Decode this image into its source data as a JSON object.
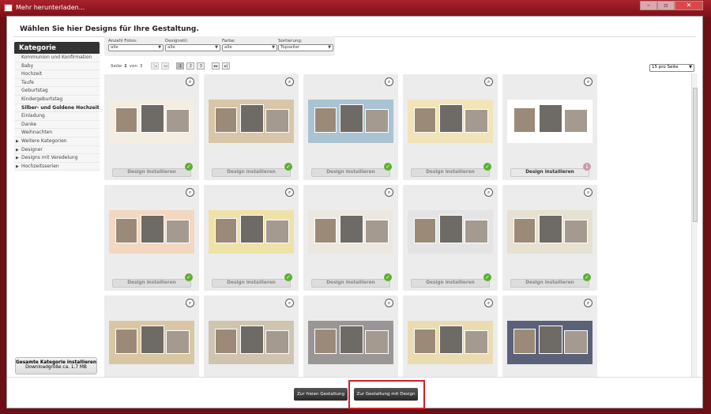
{
  "window": {
    "title": "Mehr herunterladen...",
    "controls": [
      "–",
      "▫",
      "✕"
    ]
  },
  "header": "Wählen Sie hier Designs für Ihre Gestaltung.",
  "sidebar": {
    "title": "Kategorie",
    "items": [
      {
        "label": "Kommunion und Konfirmation"
      },
      {
        "label": "Baby"
      },
      {
        "label": "Hochzeit"
      },
      {
        "label": "Taufe"
      },
      {
        "label": "Geburtstag"
      },
      {
        "label": "Kindergeburtstag"
      },
      {
        "label": "Silber- und Goldene Hochzeit",
        "selected": true
      },
      {
        "label": "Einladung"
      },
      {
        "label": "Danke"
      },
      {
        "label": "Weihnachten"
      },
      {
        "label": "Weitere Kategorien",
        "tree": true
      },
      {
        "label": "Designer",
        "tree": true
      },
      {
        "label": "Designs mit Veredelung",
        "tree": true
      },
      {
        "label": "Hochzeitsserien",
        "tree": true
      }
    ],
    "install_all": {
      "label": "Gesamte Kategorie installieren",
      "size": "Downloadgröße ca. 1.7 MB"
    }
  },
  "filters": [
    {
      "label": "Anzahl Fotos:",
      "value": "alle"
    },
    {
      "label": "Designstil:",
      "value": "alle"
    },
    {
      "label": "Farbe:",
      "value": "alle"
    },
    {
      "label": "Sortierung:",
      "value": "Topseller"
    }
  ],
  "pagination": {
    "text_pre": "Seite",
    "current": "1",
    "text_mid": "von",
    "total": "3",
    "pages": [
      "1",
      "2",
      "3"
    ],
    "first": "|◂",
    "prev": "◂◂",
    "next": "▸▸",
    "last": "▸|"
  },
  "per_page": "15 pro Seite",
  "install_label": "Design installieren",
  "cards": [
    {
      "bg": "#f3ede2",
      "badge": "check"
    },
    {
      "bg": "#d8c6a8",
      "badge": "check"
    },
    {
      "bg": "#a9c3d2",
      "badge": "check"
    },
    {
      "bg": "#f1e4b8",
      "badge": "check"
    },
    {
      "bg": "#ffffff",
      "badge": "dl",
      "active": true
    },
    {
      "bg": "#f3d7c0",
      "badge": "check"
    },
    {
      "bg": "#efe2a8",
      "badge": "check"
    },
    {
      "bg": "#ece8e0",
      "badge": "check"
    },
    {
      "bg": "#e4e4e4",
      "badge": "check"
    },
    {
      "bg": "#e6e1d0",
      "badge": "check"
    },
    {
      "bg": "#d8c7a2",
      "badge": "none"
    },
    {
      "bg": "#cfc4b0",
      "badge": "none"
    },
    {
      "bg": "#9a9696",
      "badge": "none"
    },
    {
      "bg": "#eadcb2",
      "badge": "none"
    },
    {
      "bg": "#5a6179",
      "badge": "none"
    }
  ],
  "buttons": {
    "free": "Zur freien Gestaltung",
    "design": "Zur Gestaltung mit Design"
  }
}
